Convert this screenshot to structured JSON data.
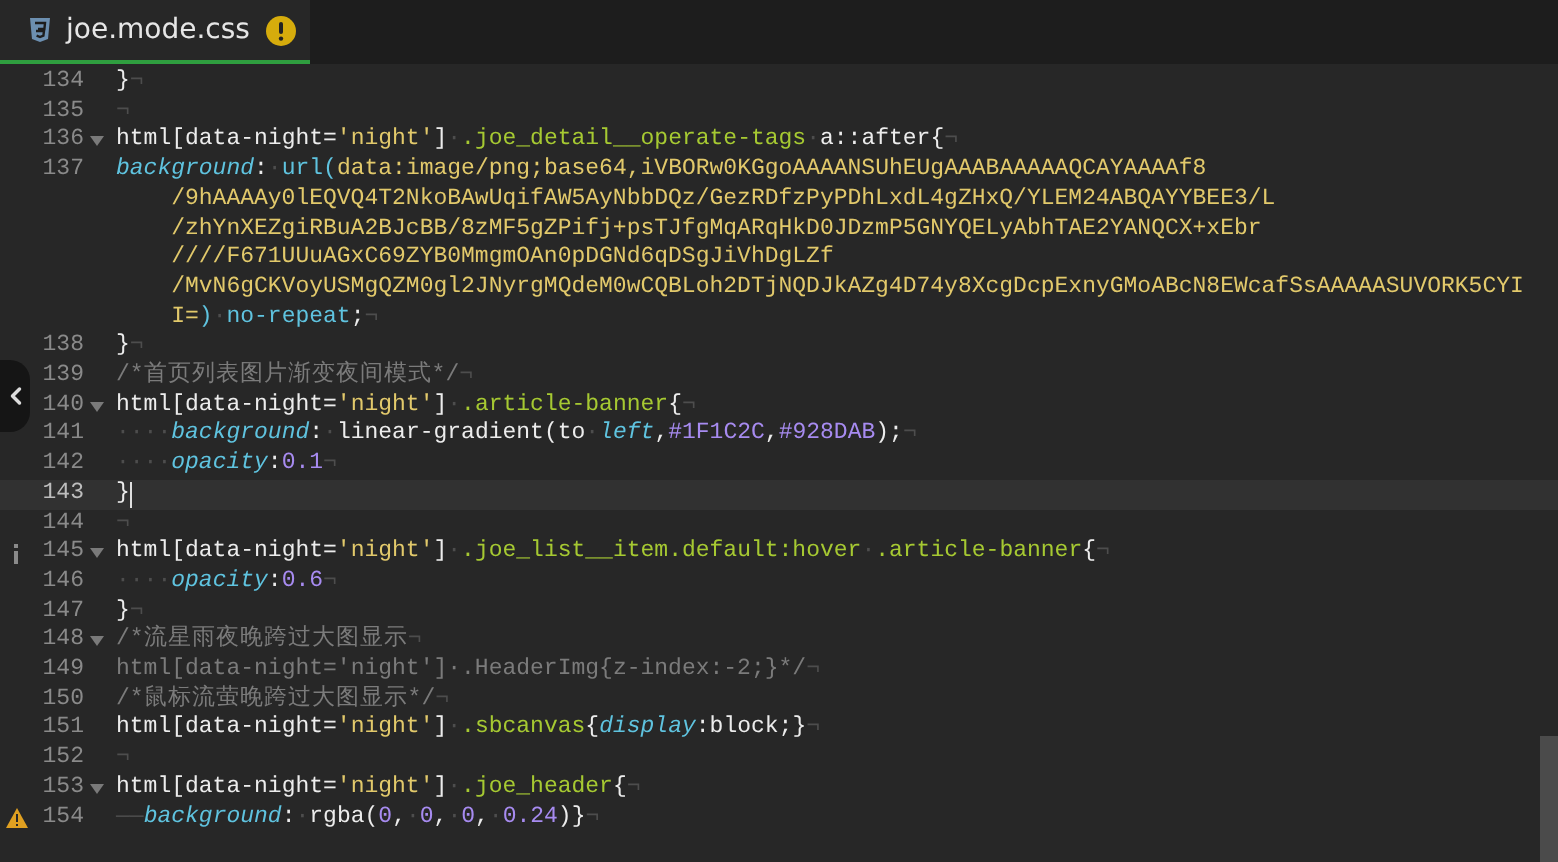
{
  "tab": {
    "filename": "joe.mode.css",
    "selected": true,
    "warning": true
  },
  "lines": [
    {
      "number": "134",
      "fold": false,
      "current": false,
      "rows": [
        {
          "tokens": [
            {
              "kind": "plain",
              "text": "}"
            },
            {
              "kind": "space",
              "text": "¬"
            }
          ]
        }
      ]
    },
    {
      "number": "135",
      "fold": false,
      "current": false,
      "rows": [
        {
          "tokens": [
            {
              "kind": "space",
              "text": "¬"
            }
          ]
        }
      ]
    },
    {
      "number": "136",
      "fold": true,
      "current": false,
      "rows": [
        {
          "tokens": [
            {
              "kind": "plain",
              "text": "html[data-night="
            },
            {
              "kind": "string",
              "text": "'night'"
            },
            {
              "kind": "plain",
              "text": "]"
            },
            {
              "kind": "space",
              "text": "·"
            },
            {
              "kind": "selector",
              "text": ".joe_detail__operate-tags"
            },
            {
              "kind": "space",
              "text": "·"
            },
            {
              "kind": "plain",
              "text": "a::after{"
            },
            {
              "kind": "space",
              "text": "¬"
            }
          ]
        }
      ]
    },
    {
      "number": "137",
      "fold": false,
      "current": false,
      "rows": [
        {
          "tokens": [
            {
              "kind": "property",
              "text": "background"
            },
            {
              "kind": "plain",
              "text": ":"
            },
            {
              "kind": "space",
              "text": "·"
            },
            {
              "kind": "function",
              "text": "url("
            },
            {
              "kind": "string",
              "text": "data:image/png;base64,iVBORw0KGgoAAAANSUhEUgAAABAAAAAQCAYAAAAf8"
            }
          ]
        },
        {
          "tokens": [
            {
              "kind": "string",
              "text": "/9hAAAAy0lEQVQ4T2NkoBAwUqifAW5AyNbbDQz/GezRDfzPyPDhLxdL4gZHxQ/YLEM24ABQAYYBEE3/L"
            }
          ]
        },
        {
          "tokens": [
            {
              "kind": "string",
              "text": "/zhYnXEZgiRBuA2BJcBB/8zMF5gZPifj+psTJfgMqARqHkD0JDzmP5GNYQELyAbhTAE2YANQCX+xEbr"
            }
          ]
        },
        {
          "tokens": [
            {
              "kind": "string",
              "text": "////F671UUuAGxC69ZYB0MmgmOAn0pDGNd6qDSgJiVhDgLZf"
            }
          ]
        },
        {
          "tokens": [
            {
              "kind": "string",
              "text": "/MvN6gCKVoyUSMgQZM0gl2JNyrgMQdeM0wCQBLoh2DTjNQDJkAZg4D74y8XcgDcpExnyGMoABcN8EWcafSsAAAAASUVORK5CYI"
            }
          ]
        },
        {
          "tokens": [
            {
              "kind": "string",
              "text": "I="
            },
            {
              "kind": "function",
              "text": ")"
            },
            {
              "kind": "space",
              "text": "·"
            },
            {
              "kind": "function",
              "text": "no-repeat"
            },
            {
              "kind": "plain",
              "text": ";"
            },
            {
              "kind": "space",
              "text": "¬"
            }
          ]
        }
      ]
    },
    {
      "number": "138",
      "fold": false,
      "current": false,
      "rows": [
        {
          "tokens": [
            {
              "kind": "plain",
              "text": "}"
            },
            {
              "kind": "space",
              "text": "¬"
            }
          ]
        }
      ]
    },
    {
      "number": "139",
      "fold": false,
      "current": false,
      "rows": [
        {
          "tokens": [
            {
              "kind": "comment",
              "text": "/*首页列表图片渐变夜间模式*/"
            },
            {
              "kind": "space",
              "text": "¬"
            }
          ]
        }
      ]
    },
    {
      "number": "140",
      "fold": true,
      "current": false,
      "rows": [
        {
          "tokens": [
            {
              "kind": "plain",
              "text": "html[data-night="
            },
            {
              "kind": "string",
              "text": "'night'"
            },
            {
              "kind": "plain",
              "text": "]"
            },
            {
              "kind": "space",
              "text": "·"
            },
            {
              "kind": "selector",
              "text": ".article-banner"
            },
            {
              "kind": "plain",
              "text": "{"
            },
            {
              "kind": "space",
              "text": "¬"
            }
          ]
        }
      ]
    },
    {
      "number": "141",
      "fold": false,
      "current": false,
      "rows": [
        {
          "tokens": [
            {
              "kind": "space",
              "text": "····"
            },
            {
              "kind": "property",
              "text": "background"
            },
            {
              "kind": "plain",
              "text": ":"
            },
            {
              "kind": "space",
              "text": "·"
            },
            {
              "kind": "plain",
              "text": "linear-gradient(to"
            },
            {
              "kind": "space",
              "text": "·"
            },
            {
              "kind": "property",
              "text": "left"
            },
            {
              "kind": "plain",
              "text": ","
            },
            {
              "kind": "number",
              "text": "#1F1C2C"
            },
            {
              "kind": "plain",
              "text": ","
            },
            {
              "kind": "number",
              "text": "#928DAB"
            },
            {
              "kind": "plain",
              "text": ");"
            },
            {
              "kind": "space",
              "text": "¬"
            }
          ]
        }
      ]
    },
    {
      "number": "142",
      "fold": false,
      "current": false,
      "rows": [
        {
          "tokens": [
            {
              "kind": "space",
              "text": "····"
            },
            {
              "kind": "property",
              "text": "opacity"
            },
            {
              "kind": "plain",
              "text": ":"
            },
            {
              "kind": "number",
              "text": "0.1"
            },
            {
              "kind": "space",
              "text": "¬"
            }
          ]
        }
      ]
    },
    {
      "number": "143",
      "fold": false,
      "current": true,
      "rows": [
        {
          "tokens": [
            {
              "kind": "plain",
              "text": "}"
            }
          ]
        }
      ]
    },
    {
      "number": "144",
      "fold": false,
      "current": false,
      "rows": [
        {
          "tokens": [
            {
              "kind": "space",
              "text": "¬"
            }
          ]
        }
      ]
    },
    {
      "number": "145",
      "fold": true,
      "current": false,
      "marker": {
        "kind": "info"
      },
      "rows": [
        {
          "tokens": [
            {
              "kind": "plain",
              "text": "html[data-night="
            },
            {
              "kind": "string",
              "text": "'night'"
            },
            {
              "kind": "plain",
              "text": "]"
            },
            {
              "kind": "space",
              "text": "·"
            },
            {
              "kind": "selector",
              "text": ".joe_list__item.default:hover"
            },
            {
              "kind": "space",
              "text": "·"
            },
            {
              "kind": "selector",
              "text": ".article-banner"
            },
            {
              "kind": "plain",
              "text": "{"
            },
            {
              "kind": "space",
              "text": "¬"
            }
          ]
        }
      ]
    },
    {
      "number": "146",
      "fold": false,
      "current": false,
      "rows": [
        {
          "tokens": [
            {
              "kind": "space",
              "text": "····"
            },
            {
              "kind": "property",
              "text": "opacity"
            },
            {
              "kind": "plain",
              "text": ":"
            },
            {
              "kind": "number",
              "text": "0.6"
            },
            {
              "kind": "space",
              "text": "¬"
            }
          ]
        }
      ]
    },
    {
      "number": "147",
      "fold": false,
      "current": false,
      "rows": [
        {
          "tokens": [
            {
              "kind": "plain",
              "text": "}"
            },
            {
              "kind": "space",
              "text": "¬"
            }
          ]
        }
      ]
    },
    {
      "number": "148",
      "fold": true,
      "current": false,
      "rows": [
        {
          "tokens": [
            {
              "kind": "comment",
              "text": "/*流星雨夜晚跨过大图显示"
            },
            {
              "kind": "space",
              "text": "¬"
            }
          ]
        }
      ]
    },
    {
      "number": "149",
      "fold": false,
      "current": false,
      "rows": [
        {
          "tokens": [
            {
              "kind": "comment",
              "text": "html[data-night='night']·.HeaderImg{z-index:-2;}*/"
            },
            {
              "kind": "space",
              "text": "¬"
            }
          ]
        }
      ]
    },
    {
      "number": "150",
      "fold": false,
      "current": false,
      "rows": [
        {
          "tokens": [
            {
              "kind": "comment",
              "text": "/*鼠标流萤晚跨过大图显示*/"
            },
            {
              "kind": "space",
              "text": "¬"
            }
          ]
        }
      ]
    },
    {
      "number": "151",
      "fold": false,
      "current": false,
      "rows": [
        {
          "tokens": [
            {
              "kind": "plain",
              "text": "html[data-night="
            },
            {
              "kind": "string",
              "text": "'night'"
            },
            {
              "kind": "plain",
              "text": "]"
            },
            {
              "kind": "space",
              "text": "·"
            },
            {
              "kind": "selector",
              "text": ".sbcanvas"
            },
            {
              "kind": "plain",
              "text": "{"
            },
            {
              "kind": "property",
              "text": "display"
            },
            {
              "kind": "plain",
              "text": ":block;}"
            },
            {
              "kind": "space",
              "text": "¬"
            }
          ]
        }
      ]
    },
    {
      "number": "152",
      "fold": false,
      "current": false,
      "rows": [
        {
          "tokens": [
            {
              "kind": "space",
              "text": "¬"
            }
          ]
        }
      ]
    },
    {
      "number": "153",
      "fold": true,
      "current": false,
      "rows": [
        {
          "tokens": [
            {
              "kind": "plain",
              "text": "html[data-night="
            },
            {
              "kind": "string",
              "text": "'night'"
            },
            {
              "kind": "plain",
              "text": "]"
            },
            {
              "kind": "space",
              "text": "·"
            },
            {
              "kind": "selector",
              "text": ".joe_header"
            },
            {
              "kind": "plain",
              "text": "{"
            },
            {
              "kind": "space",
              "text": "¬"
            }
          ]
        }
      ]
    },
    {
      "number": "154",
      "fold": false,
      "current": false,
      "marker": {
        "kind": "warning"
      },
      "rows": [
        {
          "tokens": [
            {
              "kind": "space",
              "text": "——"
            },
            {
              "kind": "property",
              "text": "background"
            },
            {
              "kind": "plain",
              "text": ":"
            },
            {
              "kind": "space",
              "text": "·"
            },
            {
              "kind": "plain",
              "text": "rgba("
            },
            {
              "kind": "number",
              "text": "0"
            },
            {
              "kind": "plain",
              "text": ","
            },
            {
              "kind": "space",
              "text": "·"
            },
            {
              "kind": "number",
              "text": "0"
            },
            {
              "kind": "plain",
              "text": ","
            },
            {
              "kind": "space",
              "text": "·"
            },
            {
              "kind": "number",
              "text": "0"
            },
            {
              "kind": "plain",
              "text": ","
            },
            {
              "kind": "space",
              "text": "·"
            },
            {
              "kind": "number",
              "text": "0.24"
            },
            {
              "kind": "plain",
              "text": ")}"
            },
            {
              "kind": "space",
              "text": "¬"
            }
          ]
        }
      ]
    }
  ]
}
